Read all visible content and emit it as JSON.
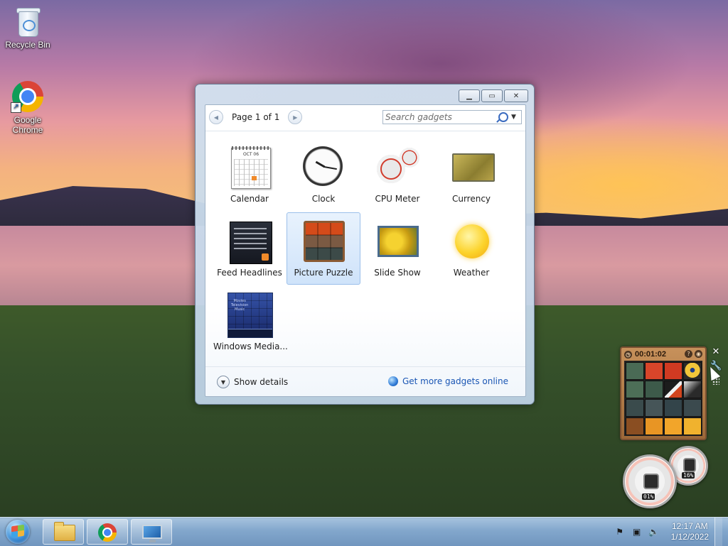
{
  "desktop": {
    "icons": [
      {
        "label": "Recycle Bin",
        "icon": "recycle-bin-icon"
      },
      {
        "label": "Google\nChrome",
        "icon": "chrome-icon"
      }
    ]
  },
  "gallery": {
    "pager": {
      "label": "Page 1 of 1",
      "prev_icon": "◀",
      "next_icon": "▶"
    },
    "search": {
      "placeholder": "Search gadgets",
      "value": ""
    },
    "gadgets": [
      {
        "label": "Calendar",
        "icon": "calendar-icon",
        "selected": false
      },
      {
        "label": "Clock",
        "icon": "clock-icon",
        "selected": false
      },
      {
        "label": "CPU Meter",
        "icon": "cpu-meter-icon",
        "selected": false
      },
      {
        "label": "Currency",
        "icon": "currency-icon",
        "selected": false
      },
      {
        "label": "Feed Headlines",
        "icon": "feed-headlines-icon",
        "selected": false
      },
      {
        "label": "Picture Puzzle",
        "icon": "picture-puzzle-icon",
        "selected": true
      },
      {
        "label": "Slide Show",
        "icon": "slide-show-icon",
        "selected": false
      },
      {
        "label": "Weather",
        "icon": "weather-icon",
        "selected": false
      },
      {
        "label": "Windows Media...",
        "icon": "windows-media-center-icon",
        "selected": false
      }
    ],
    "calendar_month": "OCT 06",
    "wmc_items": [
      "Movies",
      "Television",
      "Music"
    ],
    "footer": {
      "details_label": "Show details",
      "online_label": "Get more gadgets online"
    }
  },
  "puzzle_gadget": {
    "timer": "00:01:02"
  },
  "cpu_gadget": {
    "cpu": "01%",
    "memory": "16%"
  },
  "taskbar": {
    "items": [
      {
        "name": "file-explorer",
        "icon": "folder-icon"
      },
      {
        "name": "google-chrome",
        "icon": "chrome-icon"
      },
      {
        "name": "remote-desktop",
        "icon": "monitor-icon"
      }
    ],
    "clock": {
      "time": "12:17 AM",
      "date": "1/12/2022"
    }
  }
}
